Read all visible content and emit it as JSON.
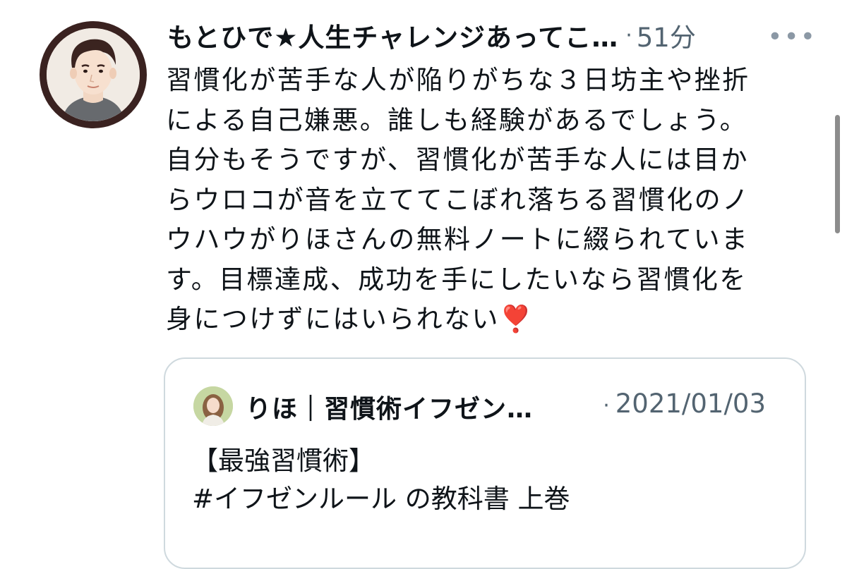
{
  "post": {
    "author": "もとひで★人生チャレンジあってこ…",
    "separator": "·",
    "time": "51分",
    "more": "•••",
    "lines": [
      "習慣化が苦手な人が陥りがちな３日坊主や挫折",
      "による自己嫌悪。誰しも経験があるでしょう。",
      "自分もそうですが、習慣化が苦手な人には目か",
      "らウロコが音を立ててこぼれ落ちる習慣化のノ",
      "ウハウがりほさんの無料ノートに綴られていま",
      "す。目標達成、成功を手にしたいなら習慣化を",
      "身につけずにはいられない"
    ],
    "emoji": "❣️"
  },
  "quote": {
    "author": "りほ｜習慣術イフゼン…",
    "separator": "·",
    "date": "2021/01/03",
    "lines": [
      "【最強習慣術】",
      "#イフゼンルール の教科書 上巻"
    ]
  }
}
